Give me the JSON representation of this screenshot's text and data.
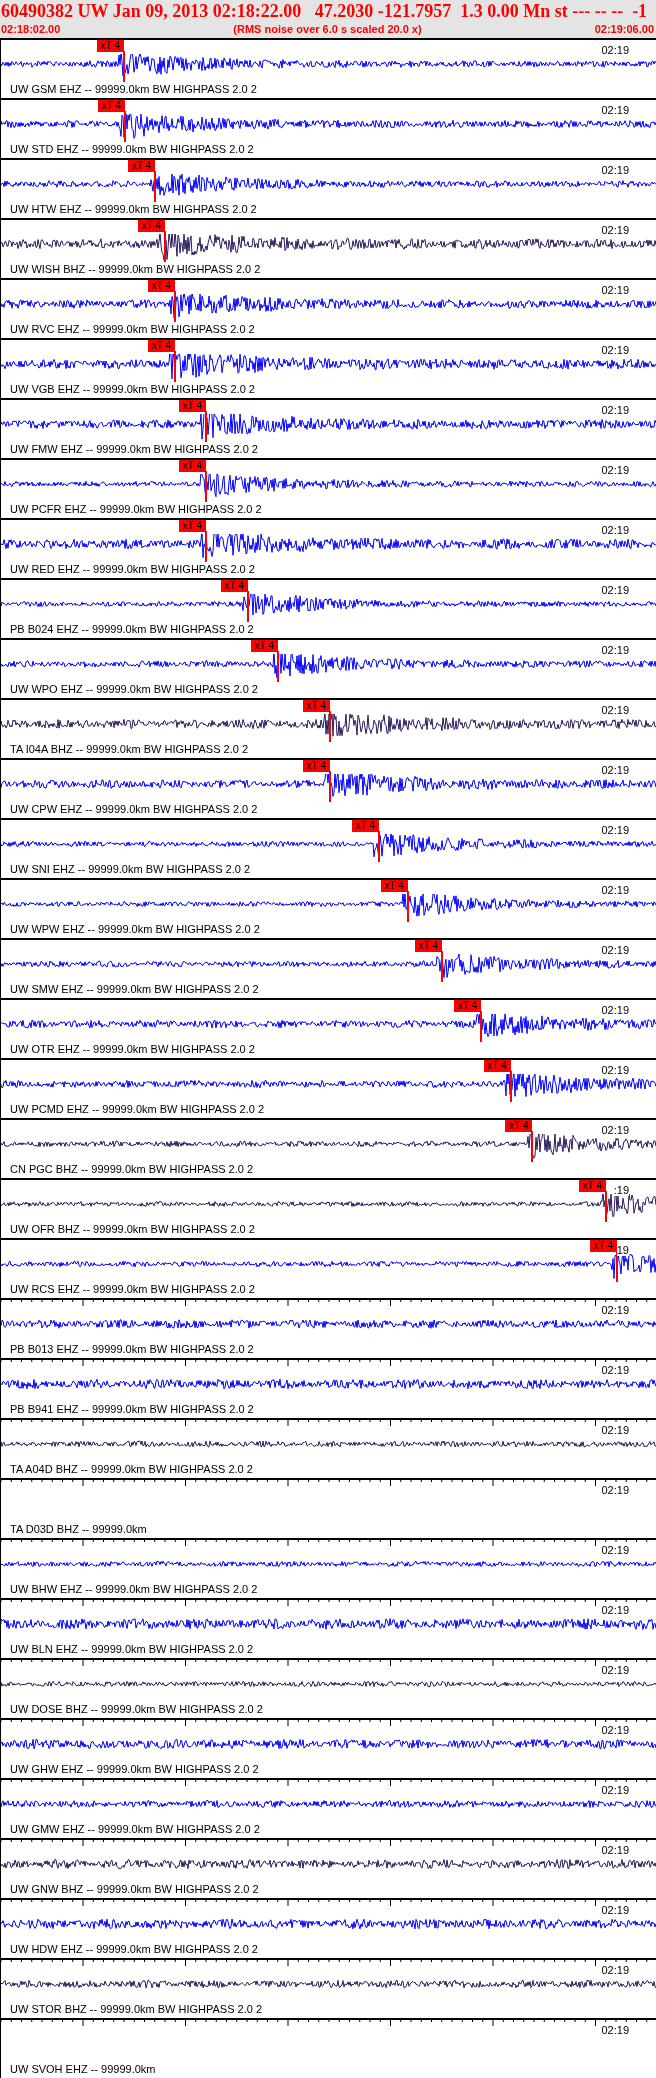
{
  "header": {
    "title": "60490382 UW Jan 09, 2013 02:18:22.00   47.2030 -121.7957  1.3 0.00 Mn st --- -- --  -1",
    "start_time": "02:18:02.00",
    "scale_note": "(RMS noise over 6.0 s scaled 20.0 x)",
    "end_time": "02:19:06.00"
  },
  "traces": [
    {
      "label": "UW GSM EHZ -- 99999.0km BW HIGHPASS 2.0 2",
      "time_label": "02:19",
      "kind": "waveform",
      "color": "#0000ff",
      "pick": {
        "label": "xT 4",
        "level": 0.1875
      }
    },
    {
      "label": "UW STD EHZ -- 99999.0km BW HIGHPASS 2.0 2",
      "time_label": "02:19",
      "kind": "waveform",
      "color": "#0000ff",
      "pick": {
        "label": "xT 4",
        "level": 0.189
      }
    },
    {
      "label": "UW HTW EHZ -- 99999.0km BW HIGHPASS 2.0 2",
      "time_label": "02:19",
      "kind": "waveform",
      "color": "#0000ff",
      "pick": {
        "label": "xT 4",
        "level": 0.235
      }
    },
    {
      "label": "UW WISH BHZ -- 99999.0km BW HIGHPASS 2.0 2",
      "time_label": "02:19",
      "kind": "waveform",
      "color": "#2b1a5c",
      "pick": {
        "label": "xT 4",
        "level": 0.25
      }
    },
    {
      "label": "UW RVC EHZ -- 99999.0km BW HIGHPASS 2.0 2",
      "time_label": "02:19",
      "kind": "waveform",
      "color": "#0000ff",
      "pick": {
        "label": "xT 4",
        "level": 0.265
      }
    },
    {
      "label": "UW VGB EHZ -- 99999.0km BW HIGHPASS 2.0 2",
      "time_label": "02:19",
      "kind": "waveform",
      "color": "#0000ff",
      "pick": {
        "label": "xT 4",
        "level": 0.265
      }
    },
    {
      "label": "UW FMW EHZ -- 99999.0km BW HIGHPASS 2.0 2",
      "time_label": "02:19",
      "kind": "waveform",
      "color": "#0000ff",
      "pick": {
        "label": "xT 4",
        "level": 0.3125
      }
    },
    {
      "label": "UW PCFR EHZ -- 99999.0km BW HIGHPASS 2.0 2",
      "time_label": "02:19",
      "kind": "waveform",
      "color": "#0000ff",
      "pick": {
        "label": "xT 4",
        "level": 0.3125
      }
    },
    {
      "label": "UW RED EHZ -- 99999.0km BW HIGHPASS 2.0 2",
      "time_label": "02:19",
      "kind": "waveform",
      "color": "#0000ff",
      "pick": {
        "label": "xT 4",
        "level": 0.3125
      }
    },
    {
      "label": "PB B024 EHZ -- 99999.0km BW HIGHPASS 2.0 2",
      "time_label": "02:19",
      "kind": "waveform",
      "color": "#0000ff",
      "pick": {
        "label": "xT 4",
        "level": 0.3765
      }
    },
    {
      "label": "UW WPO EHZ -- 99999.0km BW HIGHPASS 2.0 2",
      "time_label": "02:19",
      "kind": "waveform",
      "color": "#0000ff",
      "pick": {
        "label": "xT 4",
        "level": 0.422
      }
    },
    {
      "label": "TA I04A BHZ -- 99999.0km BW HIGHPASS 2.0 2",
      "time_label": "02:19",
      "kind": "waveform",
      "color": "#2b1a5c",
      "pick": {
        "label": "xT 4",
        "level": 0.5015
      }
    },
    {
      "label": "UW CPW EHZ -- 99999.0km BW HIGHPASS 2.0 2",
      "time_label": "02:19",
      "kind": "waveform",
      "color": "#0000ff",
      "pick": {
        "label": "xT 4",
        "level": 0.5015
      }
    },
    {
      "label": "UW SNI EHZ -- 99999.0km BW HIGHPASS 2.0 2",
      "time_label": "02:19",
      "kind": "waveform",
      "color": "#0000ff",
      "pick": {
        "label": "xT 4",
        "level": 0.576
      }
    },
    {
      "label": "UW WPW EHZ -- 99999.0km BW HIGHPASS 2.0 2",
      "time_label": "02:19",
      "kind": "waveform",
      "color": "#0000ff",
      "pick": {
        "label": "xT 4",
        "level": 0.62
      }
    },
    {
      "label": "UW SMW EHZ -- 99999.0km BW HIGHPASS 2.0 2",
      "time_label": "02:19",
      "kind": "waveform",
      "color": "#0000ff",
      "pick": {
        "label": "xT 4",
        "level": 0.672
      }
    },
    {
      "label": "UW OTR EHZ -- 99999.0km BW HIGHPASS 2.0 2",
      "time_label": "02:19",
      "kind": "waveform",
      "color": "#0000ff",
      "pick": {
        "label": "xT 4",
        "level": 0.732
      }
    },
    {
      "label": "UW PCMD EHZ -- 99999.0km BW HIGHPASS 2.0 2",
      "time_label": "02:19",
      "kind": "waveform",
      "color": "#0000ff",
      "pick": {
        "label": "xT 4",
        "level": 0.777
      }
    },
    {
      "label": "CN PGC BHZ -- 99999.0km BW HIGHPASS 2.0 2",
      "time_label": "02:19",
      "kind": "waveform",
      "color": "#2b1a5c",
      "pick": {
        "label": "xT 4",
        "level": 0.81
      }
    },
    {
      "label": "UW OFR BHZ -- 99999.0km BW HIGHPASS 2.0 2",
      "time_label": ":19",
      "kind": "waveform",
      "color": "#2b1a5c",
      "pick": {
        "label": "xT 4",
        "level": 0.922
      }
    },
    {
      "label": "UW RCS EHZ -- 99999.0km BW HIGHPASS 2.0 2",
      "time_label": "19",
      "kind": "waveform",
      "color": "#0000ff",
      "pick": {
        "label": "xT 4",
        "level": 0.939
      }
    },
    {
      "label": "PB B013 EHZ -- 99999.0km BW HIGHPASS 2.0 2",
      "time_label": "02:19",
      "kind": "waveform",
      "color": "#0000ff"
    },
    {
      "label": "PB B941 EHZ -- 99999.0km BW HIGHPASS 2.0 2",
      "time_label": "02:19",
      "kind": "waveform",
      "color": "#0000ff"
    },
    {
      "label": "TA A04D BHZ -- 99999.0km BW HIGHPASS 2.0 2",
      "time_label": "02:19",
      "kind": "waveform",
      "color": "#2b1a5c"
    },
    {
      "label": "TA D03D BHZ -- 99999.0km",
      "time_label": "02:19",
      "kind": "empty"
    },
    {
      "label": "UW BHW EHZ -- 99999.0km BW HIGHPASS 2.0 2",
      "time_label": "02:19",
      "kind": "waveform",
      "color": "#0000ff"
    },
    {
      "label": "UW BLN EHZ -- 99999.0km BW HIGHPASS 2.0 2",
      "time_label": "02:19",
      "kind": "waveform",
      "color": "#0000ff"
    },
    {
      "label": "UW DOSE BHZ -- 99999.0km BW HIGHPASS 2.0 2",
      "time_label": "02:19",
      "kind": "waveform",
      "color": "#2b1a5c"
    },
    {
      "label": "UW GHW EHZ -- 99999.0km BW HIGHPASS 2.0 2",
      "time_label": "02:19",
      "kind": "waveform",
      "color": "#0000ff"
    },
    {
      "label": "UW GMW EHZ -- 99999.0km BW HIGHPASS 2.0 2",
      "time_label": "02:19",
      "kind": "waveform",
      "color": "#0000ff"
    },
    {
      "label": "UW GNW BHZ -- 99999.0km BW HIGHPASS 2.0 2",
      "time_label": "02:19",
      "kind": "waveform",
      "color": "#2b1a5c"
    },
    {
      "label": "UW HDW EHZ -- 99999.0km BW HIGHPASS 2.0 2",
      "time_label": "02:19",
      "kind": "waveform",
      "color": "#0000ff"
    },
    {
      "label": "UW STOR BHZ -- 99999.0km BW HIGHPASS 2.0 2",
      "time_label": "02:19",
      "kind": "waveform",
      "color": "#2b1a5c"
    },
    {
      "label": "UW SVOH EHZ -- 99999.0km",
      "time_label": "02:19",
      "kind": "empty"
    }
  ]
}
